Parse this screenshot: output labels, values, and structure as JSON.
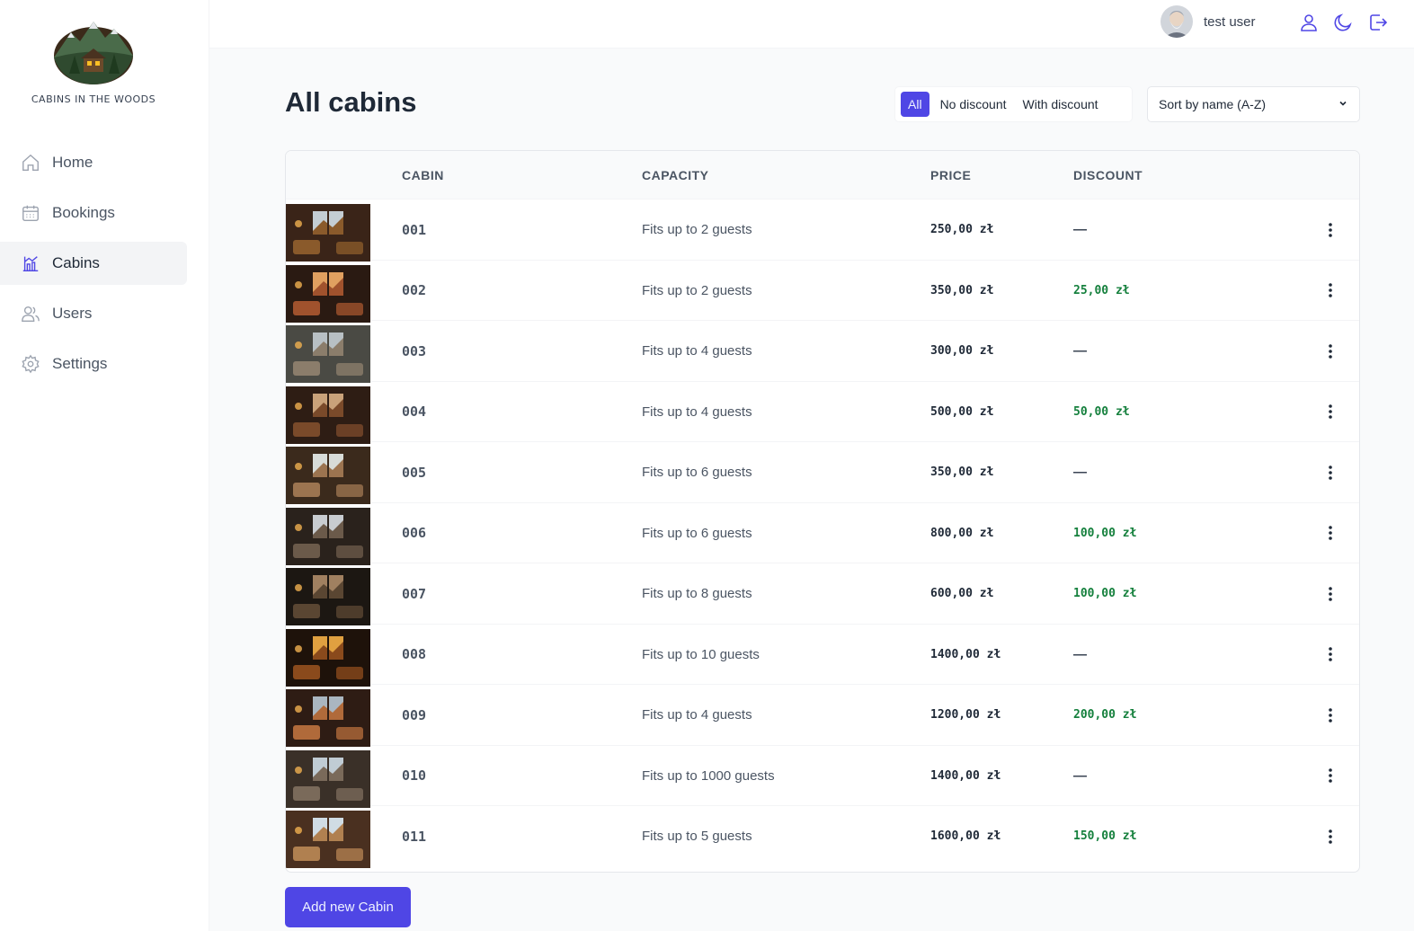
{
  "app": {
    "logo_text": "CABINS IN THE WOODS"
  },
  "sidebar": {
    "items": [
      {
        "label": "Home",
        "icon": "home-icon"
      },
      {
        "label": "Bookings",
        "icon": "calendar-icon"
      },
      {
        "label": "Cabins",
        "icon": "cabins-chart-icon",
        "active": true
      },
      {
        "label": "Users",
        "icon": "users-icon"
      },
      {
        "label": "Settings",
        "icon": "gear-icon"
      }
    ]
  },
  "header": {
    "username": "test user",
    "icons": [
      "user-icon",
      "moon-icon",
      "logout-icon"
    ]
  },
  "main": {
    "title": "All cabins",
    "filter": {
      "options": [
        "All",
        "No discount",
        "With discount"
      ],
      "active": "All"
    },
    "sort": {
      "selected": "Sort by name (A-Z)"
    },
    "table": {
      "headers": [
        "CABIN",
        "CAPACITY",
        "PRICE",
        "DISCOUNT"
      ],
      "rows": [
        {
          "name": "001",
          "capacity": "Fits up to 2 guests",
          "price": "250,00 zł",
          "discount": "—"
        },
        {
          "name": "002",
          "capacity": "Fits up to 2 guests",
          "price": "350,00 zł",
          "discount": "25,00 zł"
        },
        {
          "name": "003",
          "capacity": "Fits up to 4 guests",
          "price": "300,00 zł",
          "discount": "—"
        },
        {
          "name": "004",
          "capacity": "Fits up to 4 guests",
          "price": "500,00 zł",
          "discount": "50,00 zł"
        },
        {
          "name": "005",
          "capacity": "Fits up to 6 guests",
          "price": "350,00 zł",
          "discount": "—"
        },
        {
          "name": "006",
          "capacity": "Fits up to 6 guests",
          "price": "800,00 zł",
          "discount": "100,00 zł"
        },
        {
          "name": "007",
          "capacity": "Fits up to 8 guests",
          "price": "600,00 zł",
          "discount": "100,00 zł"
        },
        {
          "name": "008",
          "capacity": "Fits up to 10 guests",
          "price": "1400,00 zł",
          "discount": "—"
        },
        {
          "name": "009",
          "capacity": "Fits up to 4 guests",
          "price": "1200,00 zł",
          "discount": "200,00 zł"
        },
        {
          "name": "010",
          "capacity": "Fits up to 1000 guests",
          "price": "1400,00 zł",
          "discount": "—"
        },
        {
          "name": "011",
          "capacity": "Fits up to 5 guests",
          "price": "1600,00 zł",
          "discount": "150,00 zł"
        }
      ]
    },
    "add_button": "Add new Cabin"
  },
  "colors": {
    "brand": "#4f46e5",
    "discount": "#15803d"
  }
}
